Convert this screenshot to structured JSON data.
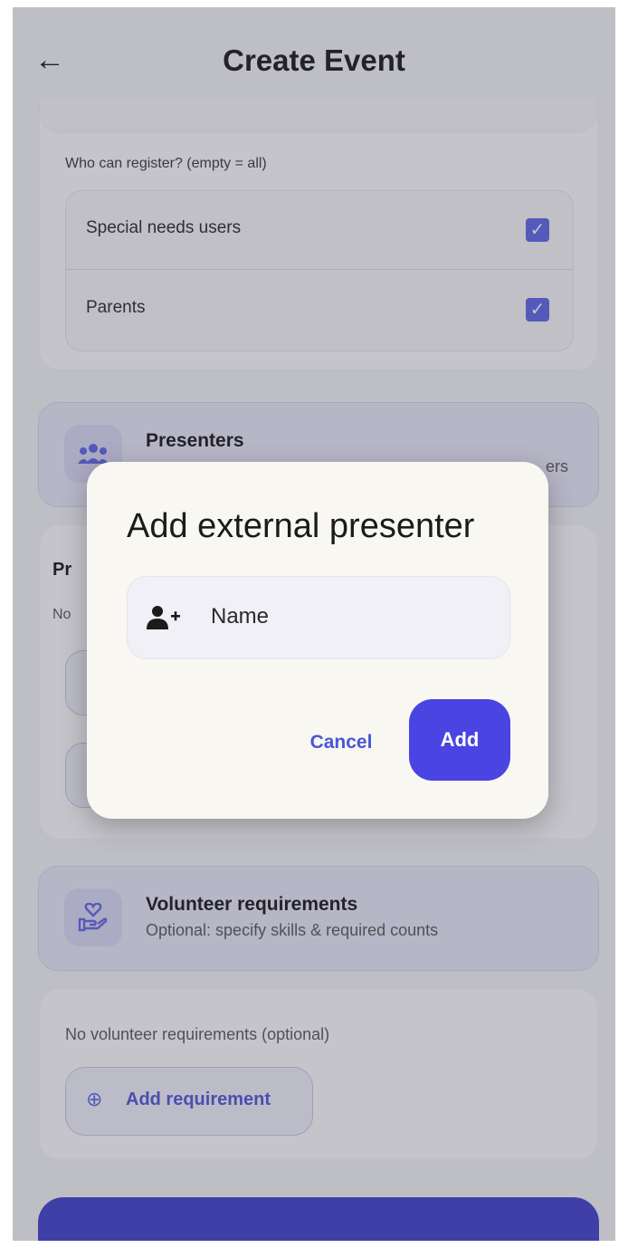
{
  "app_bar": {
    "title": "Create Event"
  },
  "registration": {
    "label": "Who can register? (empty = all)",
    "options": [
      {
        "label": "Special needs users",
        "checked": true
      },
      {
        "label": "Parents",
        "checked": true
      }
    ]
  },
  "presenters_section": {
    "title": "Presenters",
    "subtitle_fragment": "ers"
  },
  "presenters_card": {
    "heading_fragment": "Pr",
    "text_fragment": "No"
  },
  "volunteer_section": {
    "title": "Volunteer requirements",
    "subtitle": "Optional: specify skills & required counts"
  },
  "volunteer_card": {
    "empty_text": "No volunteer requirements (optional)",
    "add_button_label": "Add requirement"
  },
  "dialog": {
    "title": "Add external presenter",
    "name_placeholder": "Name",
    "cancel_label": "Cancel",
    "add_label": "Add"
  },
  "colors": {
    "accent": "#4a44e3",
    "checkbox": "#5b63e6",
    "primary_button": "#3b3ccc"
  }
}
